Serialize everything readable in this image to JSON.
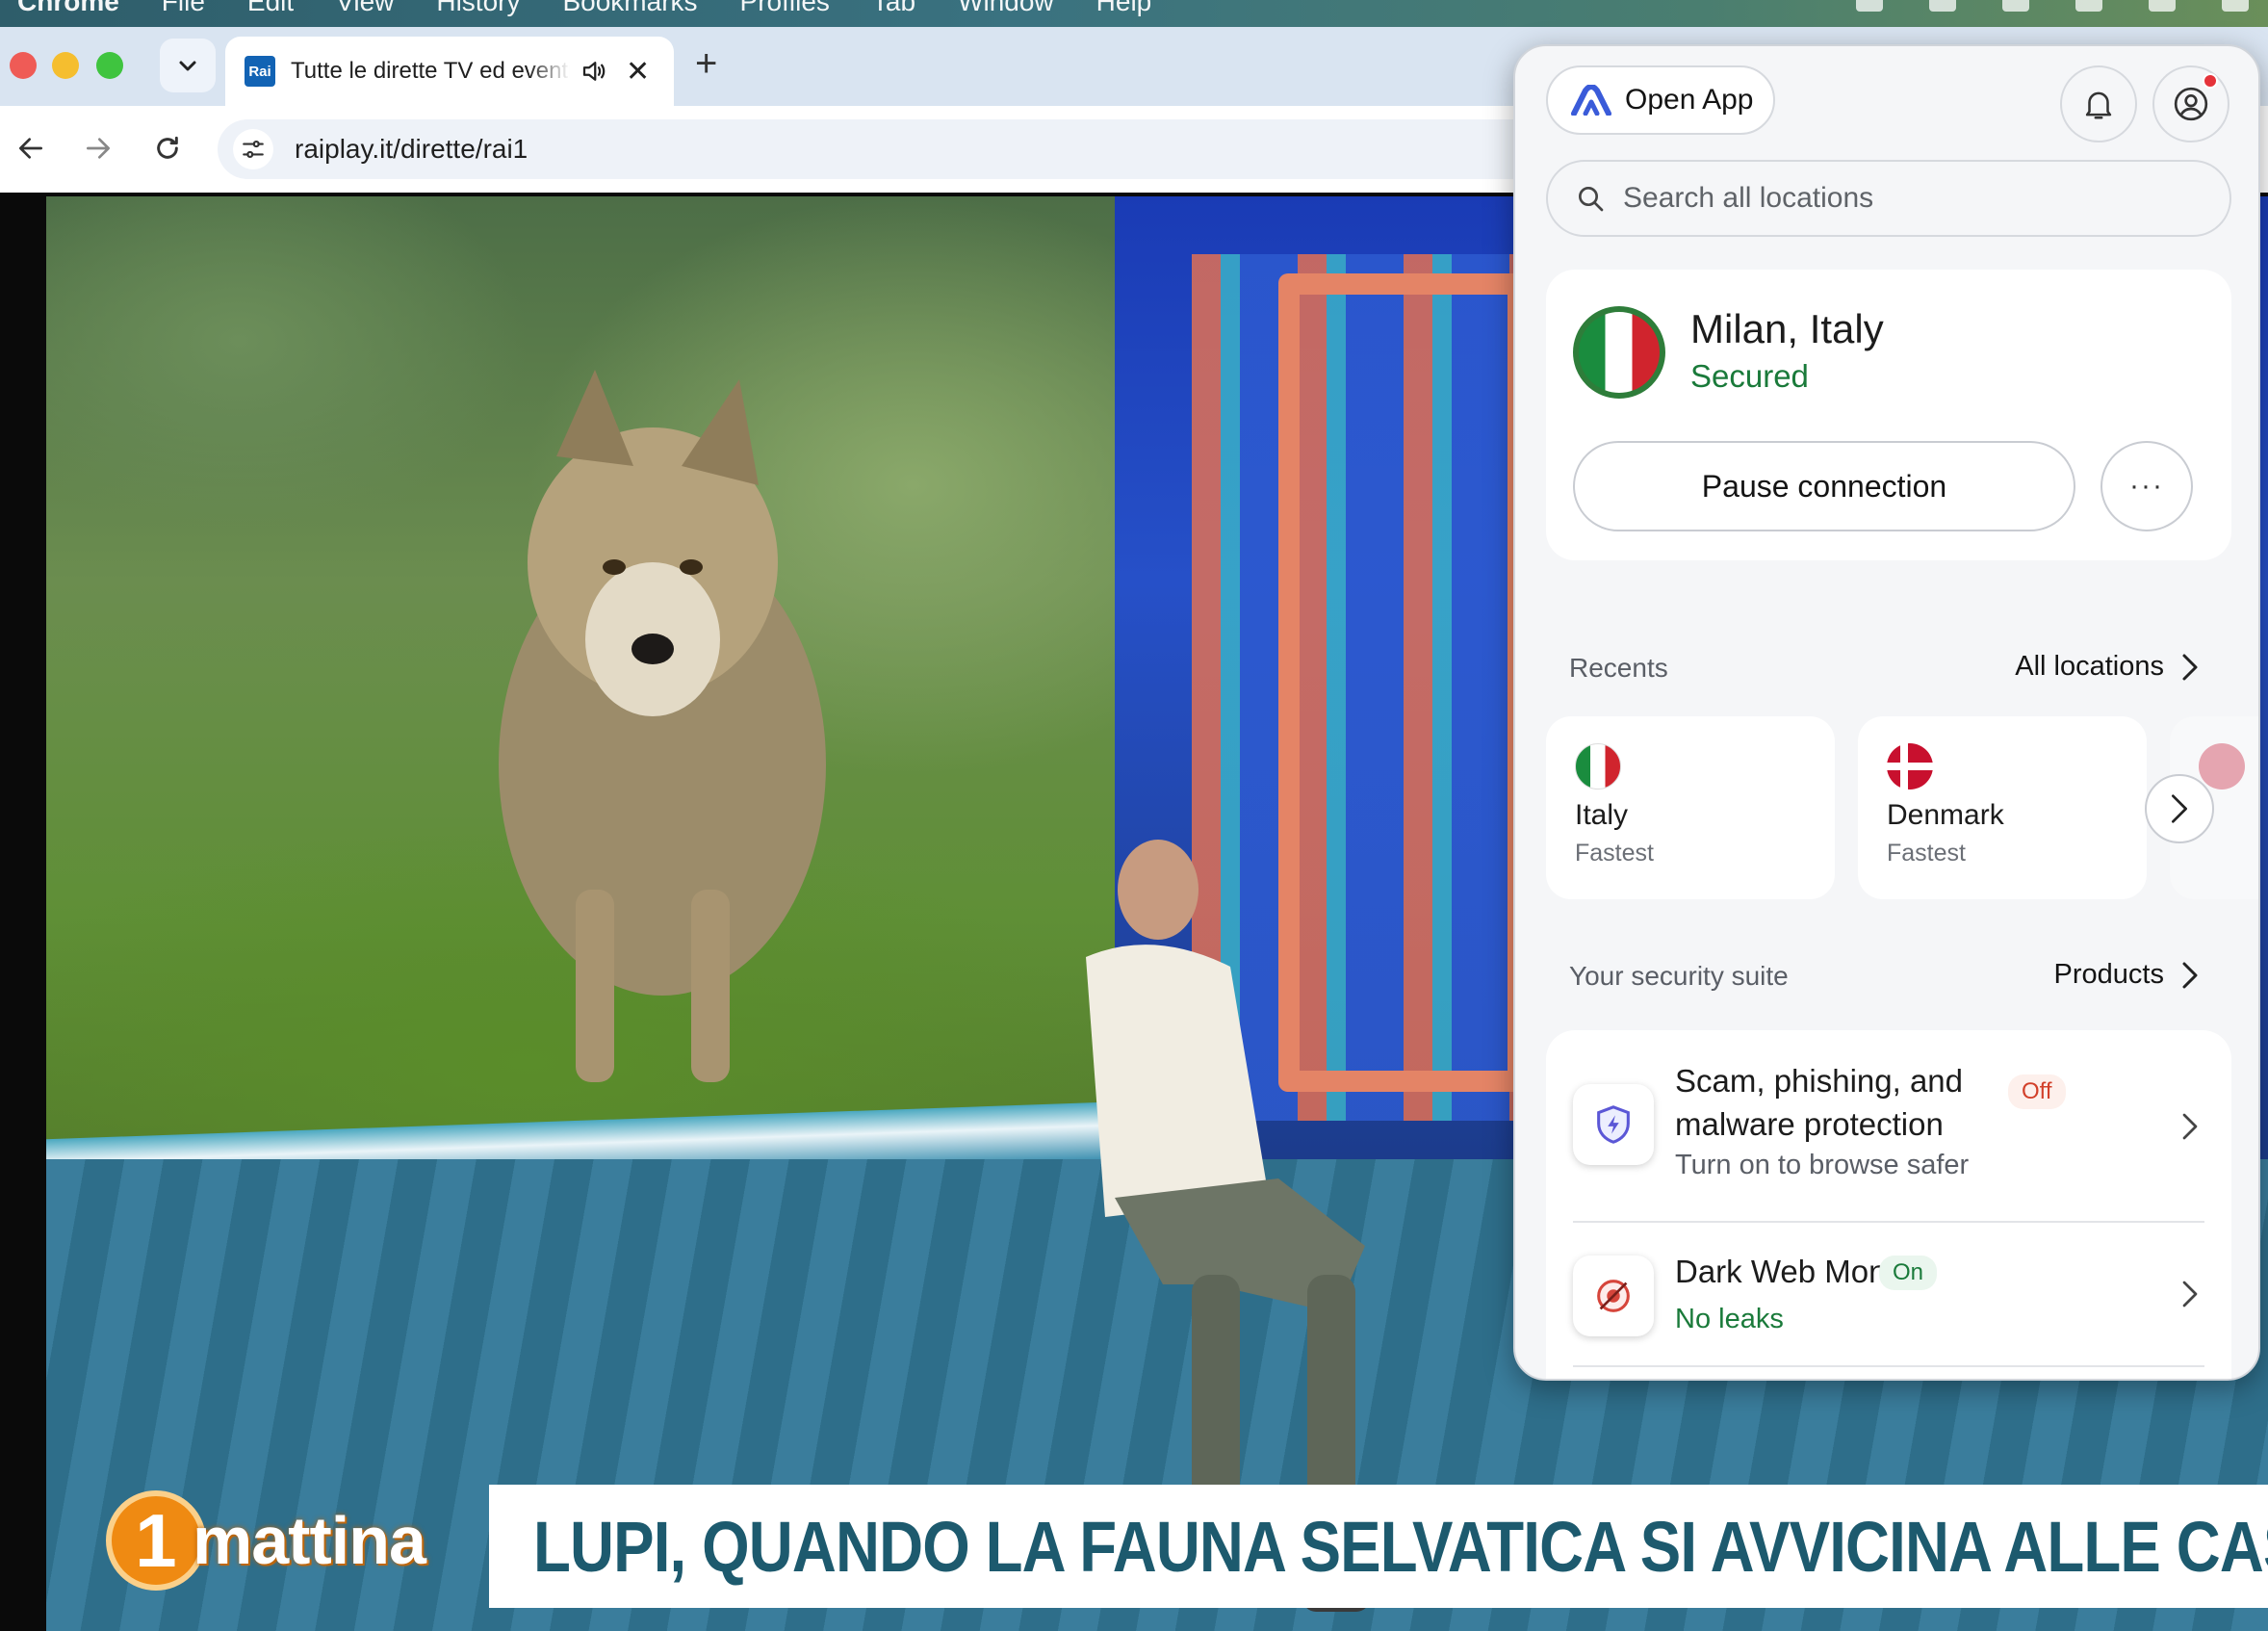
{
  "menubar": {
    "items": [
      "Chrome",
      "File",
      "Edit",
      "View",
      "History",
      "Bookmarks",
      "Profiles",
      "Tab",
      "Window",
      "Help"
    ]
  },
  "browser": {
    "tab": {
      "favicon": "Rai",
      "title": "Tutte le dirette TV ed eventi",
      "icons": [
        "speaker-icon",
        "close-icon"
      ]
    },
    "url": "raiplay.it/dirette/rai1"
  },
  "video": {
    "logo_number": "1",
    "logo_word": "mattina",
    "headline": "LUPI, QUANDO LA FAUNA SELVATICA SI AVVICINA ALLE CASE"
  },
  "vpn": {
    "open_app_label": "Open App",
    "search_placeholder": "Search all locations",
    "connection": {
      "city": "Milan, Italy",
      "status": "Secured",
      "pause_label": "Pause connection",
      "more_label": "···"
    },
    "recents": {
      "label": "Recents",
      "link": "All locations",
      "items": [
        {
          "name": "Italy",
          "sub": "Fastest"
        },
        {
          "name": "Denmark",
          "sub": "Fastest"
        }
      ]
    },
    "suite": {
      "label": "Your security suite",
      "link": "Products",
      "features": [
        {
          "title": "Scam, phishing, and malware protection",
          "badge": "Off",
          "sub": "Turn on to browse safer"
        },
        {
          "title": "Dark Web Monitor",
          "badge": "On",
          "sub": "No leaks"
        }
      ]
    },
    "colors": {
      "secured_green": "#1a7a3a",
      "off_red": "#d2402a",
      "brand_blue": "#3a5bd9"
    }
  }
}
